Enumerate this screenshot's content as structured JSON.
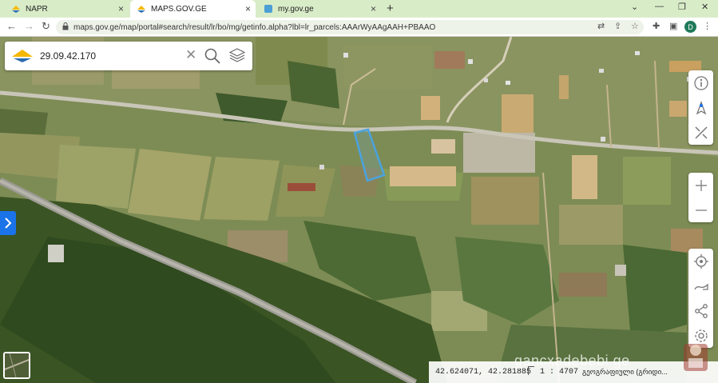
{
  "browser": {
    "tabs": [
      {
        "title": "NAPR",
        "active": false
      },
      {
        "title": "MAPS.GOV.GE",
        "active": true
      },
      {
        "title": "my.gov.ge",
        "active": false
      }
    ],
    "url": "maps.gov.ge/map/portal#search/result/lr/bo/mg/getinfo.alpha?lbl=lr_parcels:AAArWyAAgAAH+PBAAO",
    "profile_initial": "D"
  },
  "search": {
    "query": "29.09.42.170"
  },
  "status": {
    "coordinates": "42.624071, 42.281885",
    "scale": "1 : 4707",
    "layer_name": "გეოგრაფიული (გრიდი..."
  },
  "watermark": "gancxadebebi.ge",
  "colors": {
    "parcel_outline": "#4aa3df",
    "accent_blue": "#1a73e8",
    "logo_yellow": "#f5b800",
    "logo_blue": "#2b6cb0"
  },
  "icons": {
    "toolbar_top": [
      "info-icon",
      "north-arrow-icon",
      "measure-tools-icon"
    ],
    "toolbar_zoom": [
      "zoom-in-icon",
      "zoom-out-icon"
    ],
    "toolbar_bottom": [
      "locate-icon",
      "draw-icon",
      "share-icon",
      "settings-icon"
    ]
  }
}
